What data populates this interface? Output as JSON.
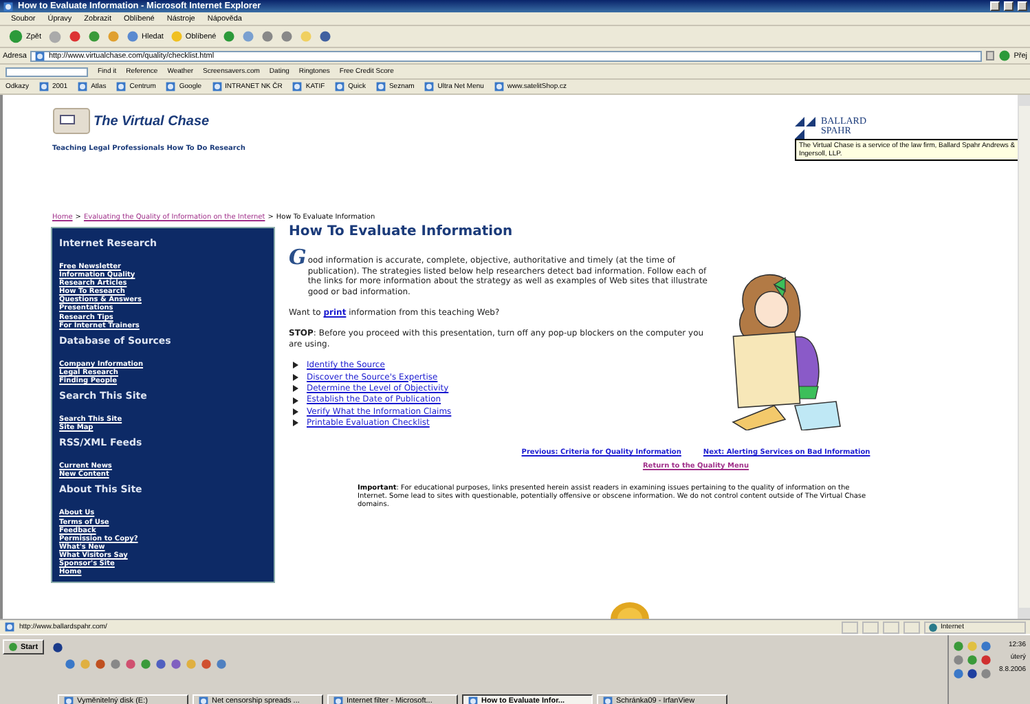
{
  "window": {
    "title": "How to Evaluate Information - Microsoft Internet Explorer"
  },
  "menu": [
    "Soubor",
    "Úpravy",
    "Zobrazit",
    "Oblíbené",
    "Nástroje",
    "Nápověda"
  ],
  "toolbar": {
    "back": "Zpět",
    "search": "Hledat",
    "favorites": "Oblíbené"
  },
  "address": {
    "label": "Adresa",
    "value": "http://www.virtualchase.com/quality/checklist.html",
    "go": "Přej"
  },
  "yahoo_bar": [
    "Find it",
    "Reference",
    "Weather",
    "Screensavers.com",
    "Dating",
    "Ringtones",
    "Free Credit Score"
  ],
  "links_bar": {
    "label": "Odkazy",
    "items": [
      "2001",
      "Atlas",
      "Centrum",
      "Google",
      "INTRANET NK ČR",
      "KATIF",
      "Quick",
      "Seznam",
      "Ultra Net Menu",
      "www.satelitShop.cz"
    ]
  },
  "header": {
    "logo": "The Virtual Chase",
    "tagline": "Teaching Legal Professionals How To Do Research",
    "sponsor": [
      "BALLARD",
      "SPAHR"
    ],
    "tooltip": "The Virtual Chase is a service of the law firm, Ballard Spahr Andrews & Ingersoll, LLP."
  },
  "breadcrumb": [
    {
      "kind": "link",
      "text": "Home"
    },
    {
      "kind": "separator",
      "text": ">"
    },
    {
      "kind": "link",
      "text": "Evaluating the Quality of Information on the Internet"
    },
    {
      "kind": "separator",
      "text": ">"
    },
    {
      "kind": "current",
      "text": "How To Evaluate Information"
    }
  ],
  "sidebar": [
    {
      "heading": "Internet Research",
      "links": [
        "Free Newsletter",
        "Information Quality",
        "Research Articles",
        "How To Research",
        "Questions & Answers",
        "Presentations",
        "Research Tips",
        "For Internet Trainers"
      ]
    },
    {
      "heading": "Database of Sources",
      "links": [
        "Company Information",
        "Legal Research",
        "Finding People"
      ]
    },
    {
      "heading": "Search This Site",
      "links": [
        "Search This Site",
        "Site Map"
      ]
    },
    {
      "heading": "RSS/XML Feeds",
      "links": [
        "Current News",
        "New Content"
      ]
    },
    {
      "heading": "About This Site",
      "links": [
        "About Us",
        "Terms of Use",
        "Feedback",
        "Permission to Copy?",
        "What's New",
        "What Visitors Say",
        "Sponsor's Site",
        "Home"
      ]
    }
  ],
  "content": {
    "title": "How To Evaluate Information",
    "drop_cap": "G",
    "intro": "ood information is accurate, complete, objective, authoritative and timely (at the time of publication). The strategies listed below help researchers detect bad information. Follow each of the links for more information about the strategy as well as examples of Web sites that illustrate good or bad information.",
    "print_before": "Want to",
    "print_link": "print",
    "print_after": "information from this teaching Web?",
    "stop": "**STOP**: Before you proceed with this presentation, turn off any pop-up blockers on the computer you are using.",
    "strategies": [
      "Identify the Source",
      "Discover the Source's Expertise",
      "Determine the Level of Objectivity",
      "Establish the Date of Publication",
      "Verify What the Information Claims",
      "Printable Evaluation Checklist"
    ],
    "previous": "Previous: Criteria for Quality Information",
    "next": "Next: Alerting Services on Bad Information",
    "return": "Return to the Quality Menu",
    "important": "**Important**: For educational purposes, links presented herein assist readers in examining issues pertaining to the quality of information on the Internet. Some lead to sites with questionable, potentially offensive or obscene information. We do not control content outside of The Virtual Chase domains."
  },
  "status_bar": {
    "url": "http://www.ballardspahr.com/",
    "zone": "Internet"
  },
  "taskbar": {
    "start": "Start",
    "tasks": [
      {
        "label": "Vyměnitelný disk (E:)",
        "selected": false
      },
      {
        "label": "Net censorship spreads ...",
        "selected": false
      },
      {
        "label": "Internet filter - Microsoft...",
        "selected": false
      },
      {
        "label": "How to Evaluate Infor...",
        "selected": true
      },
      {
        "label": "Schránka09 - IrfanView",
        "selected": false
      }
    ],
    "time": "12:36",
    "day": "úterý",
    "date": "8.8.2006"
  }
}
